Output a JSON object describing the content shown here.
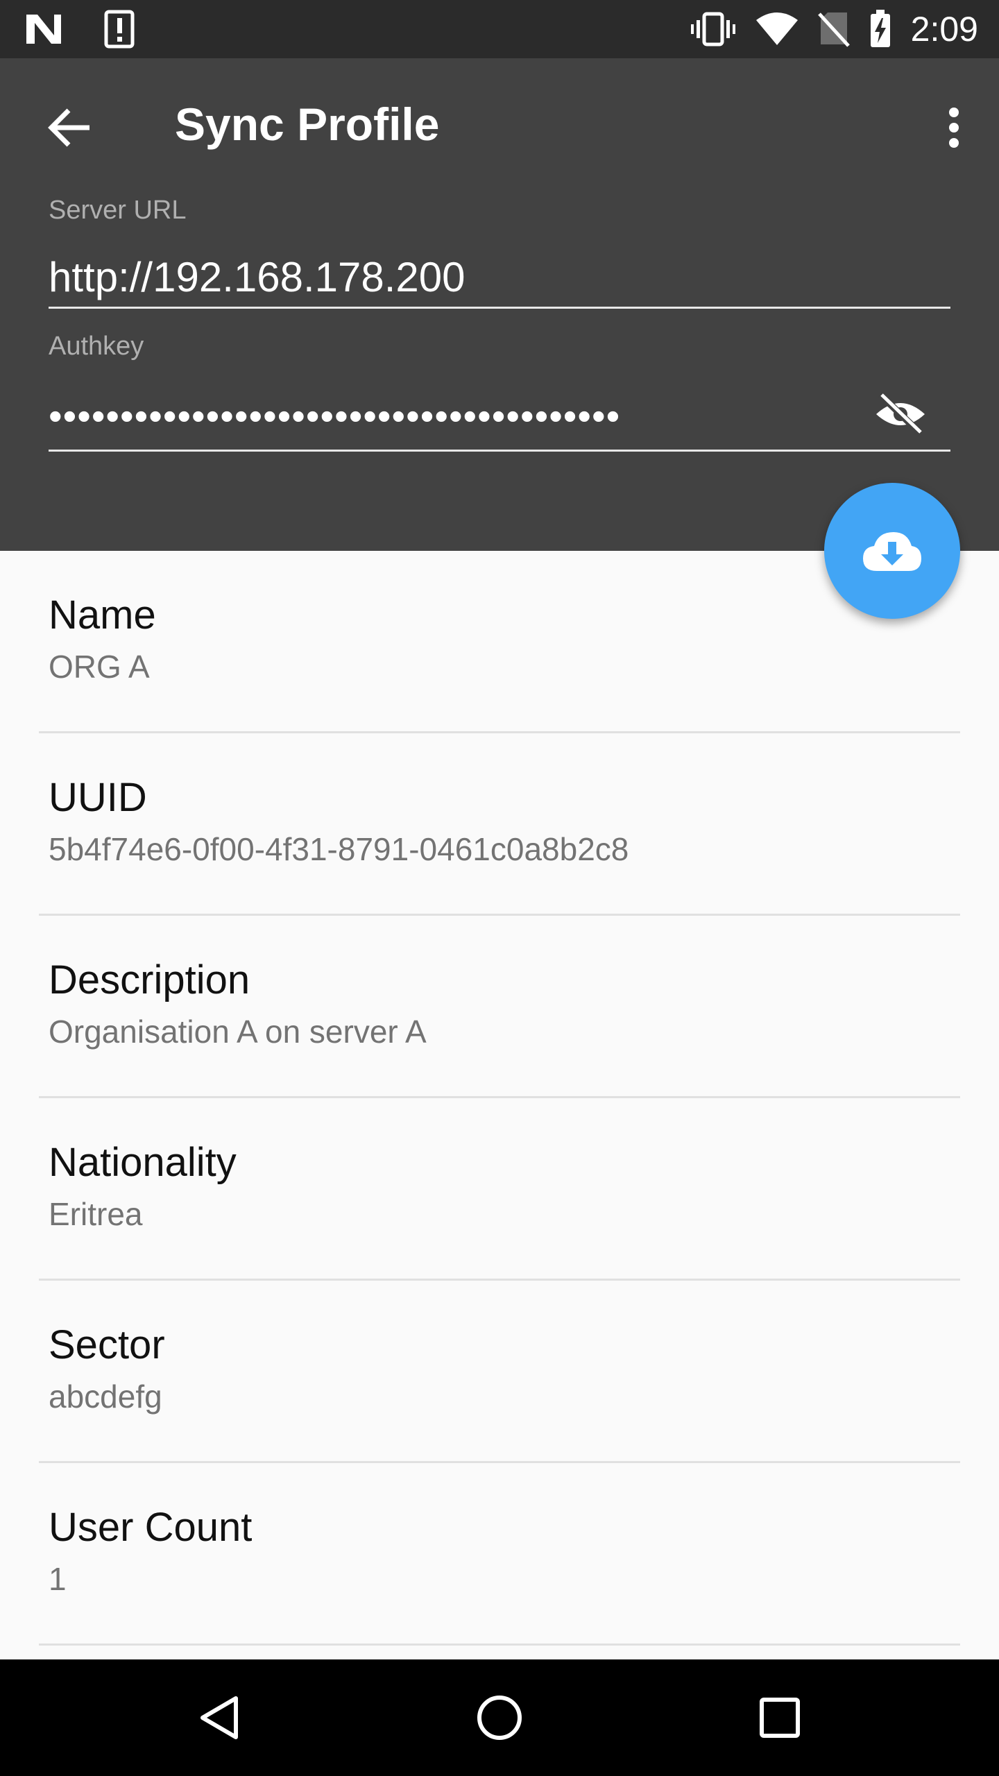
{
  "status_bar": {
    "time": "2:09",
    "left_icons": [
      "n-logo-icon",
      "alert-icon"
    ],
    "right_icons": [
      "vibrate-icon",
      "wifi-icon",
      "no-sim-icon",
      "battery-charging-icon"
    ]
  },
  "app_bar": {
    "title": "Sync Profile",
    "back_icon": "arrow-back-icon",
    "menu_icon": "more-vert-icon",
    "background": "#424242"
  },
  "form": {
    "server_url_label": "Server URL",
    "server_url_value": "http://192.168.178.200",
    "authkey_label": "Authkey",
    "authkey_value": "••••••••••••••••••••••••••••••••••••••••",
    "visibility_icon": "visibility-off-icon"
  },
  "fab": {
    "icon": "cloud-download-icon",
    "color": "#42a5f5"
  },
  "details": [
    {
      "title": "Name",
      "value": "ORG A"
    },
    {
      "title": "UUID",
      "value": "5b4f74e6-0f00-4f31-8791-0461c0a8b2c8"
    },
    {
      "title": "Description",
      "value": "Organisation A on server A"
    },
    {
      "title": "Nationality",
      "value": "Eritrea"
    },
    {
      "title": "Sector",
      "value": "abcdefg"
    },
    {
      "title": "User Count",
      "value": "1"
    }
  ],
  "nav_bar": {
    "icons": [
      "back-triangle-icon",
      "home-circle-icon",
      "recents-square-icon"
    ]
  }
}
